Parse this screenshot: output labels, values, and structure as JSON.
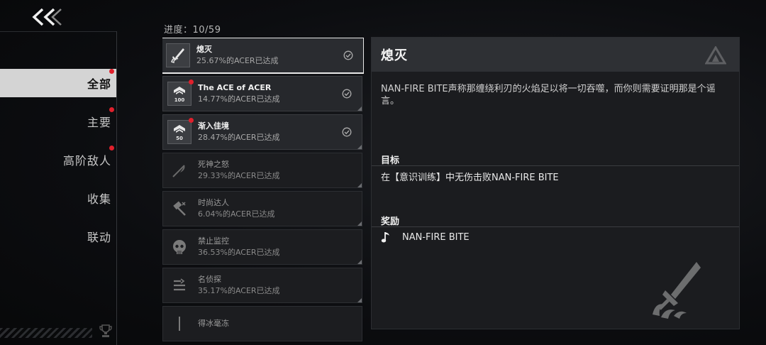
{
  "back": {
    "icon": "double-chevron-left-icon"
  },
  "sidebar": {
    "items": [
      {
        "label": "全部",
        "active": true,
        "dot": true
      },
      {
        "label": "主要",
        "active": false,
        "dot": true
      },
      {
        "label": "高阶敌人",
        "active": false,
        "dot": true
      },
      {
        "label": "收集",
        "active": false,
        "dot": false
      },
      {
        "label": "联动",
        "active": false,
        "dot": false
      }
    ]
  },
  "progress": {
    "text": "进度：10/59"
  },
  "achievements": [
    {
      "name": "熄灭",
      "pct": "25.67%的ACER已达成",
      "icon": "sword-flame-icon",
      "completed": true,
      "selected": true,
      "dot": false
    },
    {
      "name": "The ACE of ACER",
      "pct": "14.77%的ACER已达成",
      "icon": "badge-100-icon",
      "badge": "100",
      "completed": true,
      "selected": false,
      "dot": true
    },
    {
      "name": "渐入佳境",
      "pct": "28.47%的ACER已达成",
      "icon": "badge-50-icon",
      "badge": "50",
      "completed": true,
      "selected": false,
      "dot": true
    },
    {
      "name": "死神之怒",
      "pct": "29.33%的ACER已达成",
      "icon": "scythe-icon",
      "completed": false
    },
    {
      "name": "时尚达人",
      "pct": "6.04%的ACER已达成",
      "icon": "hammer-icon",
      "completed": false
    },
    {
      "name": "禁止监控",
      "pct": "36.53%的ACER已达成",
      "icon": "skull-icon",
      "completed": false
    },
    {
      "name": "名侦探",
      "pct": "35.17%的ACER已达成",
      "icon": "list-icon",
      "completed": false
    },
    {
      "name": "得冰毫冻",
      "pct": "",
      "icon": "ice-icon",
      "completed": false
    }
  ],
  "detail": {
    "title": "熄灭",
    "description": "NAN-FIRE BITE声称那缠绕利刃的火焰足以将一切吞噬，而你则需要证明那是个谣言。",
    "goal_title": "目标",
    "goal_text": "在【意识训练】中无伤击败NAN-FIRE BITE",
    "reward_title": "奖励",
    "reward_text": "NAN-FIRE BITE",
    "reward_icon": "music-note-icon"
  }
}
